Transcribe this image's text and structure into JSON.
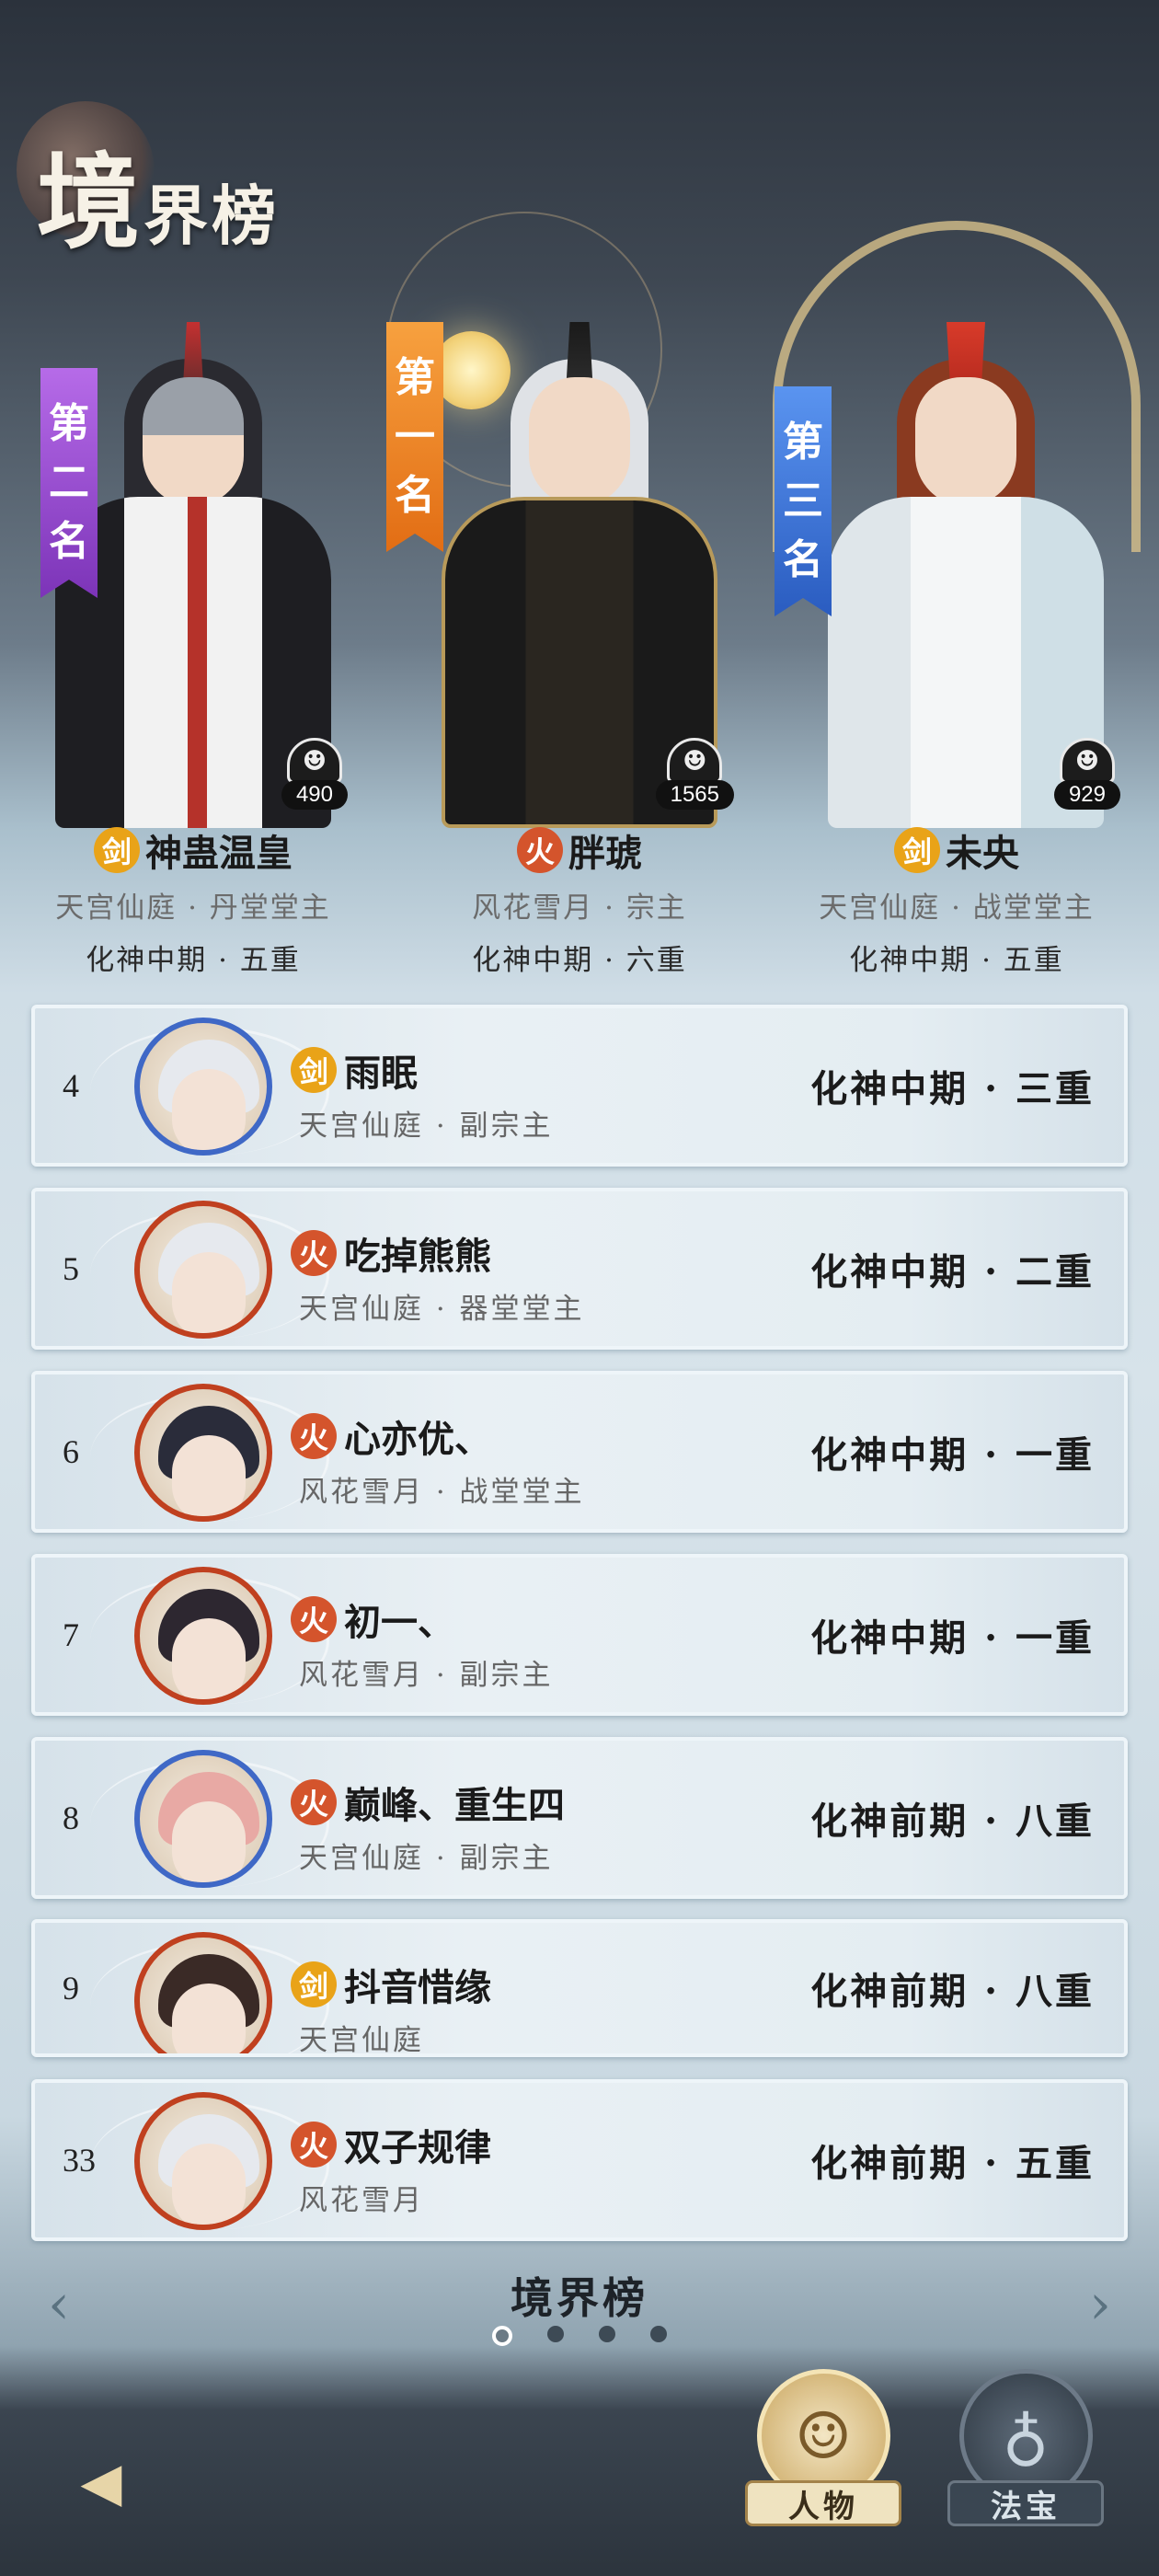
{
  "page": {
    "title_big": "境",
    "title_small": "界榜"
  },
  "top3": [
    {
      "rank_label": [
        "第",
        "二",
        "名"
      ],
      "badge": "剑",
      "badge_type": "sword",
      "name": "神蛊温皇",
      "sect": "天宫仙庭 · 丹堂堂主",
      "realm": "化神中期 · 五重",
      "power": "490",
      "banner_color": "#9a4fd6"
    },
    {
      "rank_label": [
        "第",
        "一",
        "名"
      ],
      "badge": "火",
      "badge_type": "fire",
      "name": "胖琥",
      "sect": "风花雪月 · 宗主",
      "realm": "化神中期 · 六重",
      "power": "1565",
      "banner_color": "#f08a2a"
    },
    {
      "rank_label": [
        "第",
        "三",
        "名"
      ],
      "badge": "剑",
      "badge_type": "sword",
      "name": "未央",
      "sect": "天宫仙庭 · 战堂堂主",
      "realm": "化神中期 · 五重",
      "power": "929",
      "banner_color": "#3a74d8"
    }
  ],
  "rows": [
    {
      "rank": "4",
      "badge": "剑",
      "badge_type": "sword",
      "name": "雨眠",
      "sect": "天宫仙庭 · 副宗主",
      "realm": "化神中期 · 三重",
      "hair_color": "#e6e9ee",
      "frame_color": "#3f68c6"
    },
    {
      "rank": "5",
      "badge": "火",
      "badge_type": "fire",
      "name": "吃掉熊熊",
      "sect": "天宫仙庭 · 器堂堂主",
      "realm": "化神中期 · 二重",
      "hair_color": "#e6e9ee",
      "frame_color": "#c0401f"
    },
    {
      "rank": "6",
      "badge": "火",
      "badge_type": "fire",
      "name": "心亦优、",
      "sect": "风花雪月 · 战堂堂主",
      "realm": "化神中期 · 一重",
      "hair_color": "#2a2c3a",
      "frame_color": "#c0401f"
    },
    {
      "rank": "7",
      "badge": "火",
      "badge_type": "fire",
      "name": "初一、",
      "sect": "风花雪月 · 副宗主",
      "realm": "化神中期 · 一重",
      "hair_color": "#2d2730",
      "frame_color": "#c0401f"
    },
    {
      "rank": "8",
      "badge": "火",
      "badge_type": "fire",
      "name": "巅峰、重生四",
      "sect": "天宫仙庭 · 副宗主",
      "realm": "化神前期 · 八重",
      "hair_color": "#e8a9a4",
      "frame_color": "#3f68c6"
    },
    {
      "rank": "9",
      "badge": "剑",
      "badge_type": "sword",
      "name": "抖音惜缘",
      "sect": "天宫仙庭",
      "realm": "化神前期 · 八重",
      "hair_color": "#3a2a26",
      "frame_color": "#c0401f"
    },
    {
      "rank": "33",
      "badge": "火",
      "badge_type": "fire",
      "name": "双子规律",
      "sect": "风花雪月",
      "realm": "化神前期 · 五重",
      "hair_color": "#e6e9ee",
      "frame_color": "#c0401f"
    }
  ],
  "footer": {
    "title": "境界榜",
    "page_count": 4,
    "active_page": 1
  },
  "nav": {
    "back_icon": "back-arrow-icon",
    "tab_character": "人物",
    "tab_treasure": "法宝"
  }
}
